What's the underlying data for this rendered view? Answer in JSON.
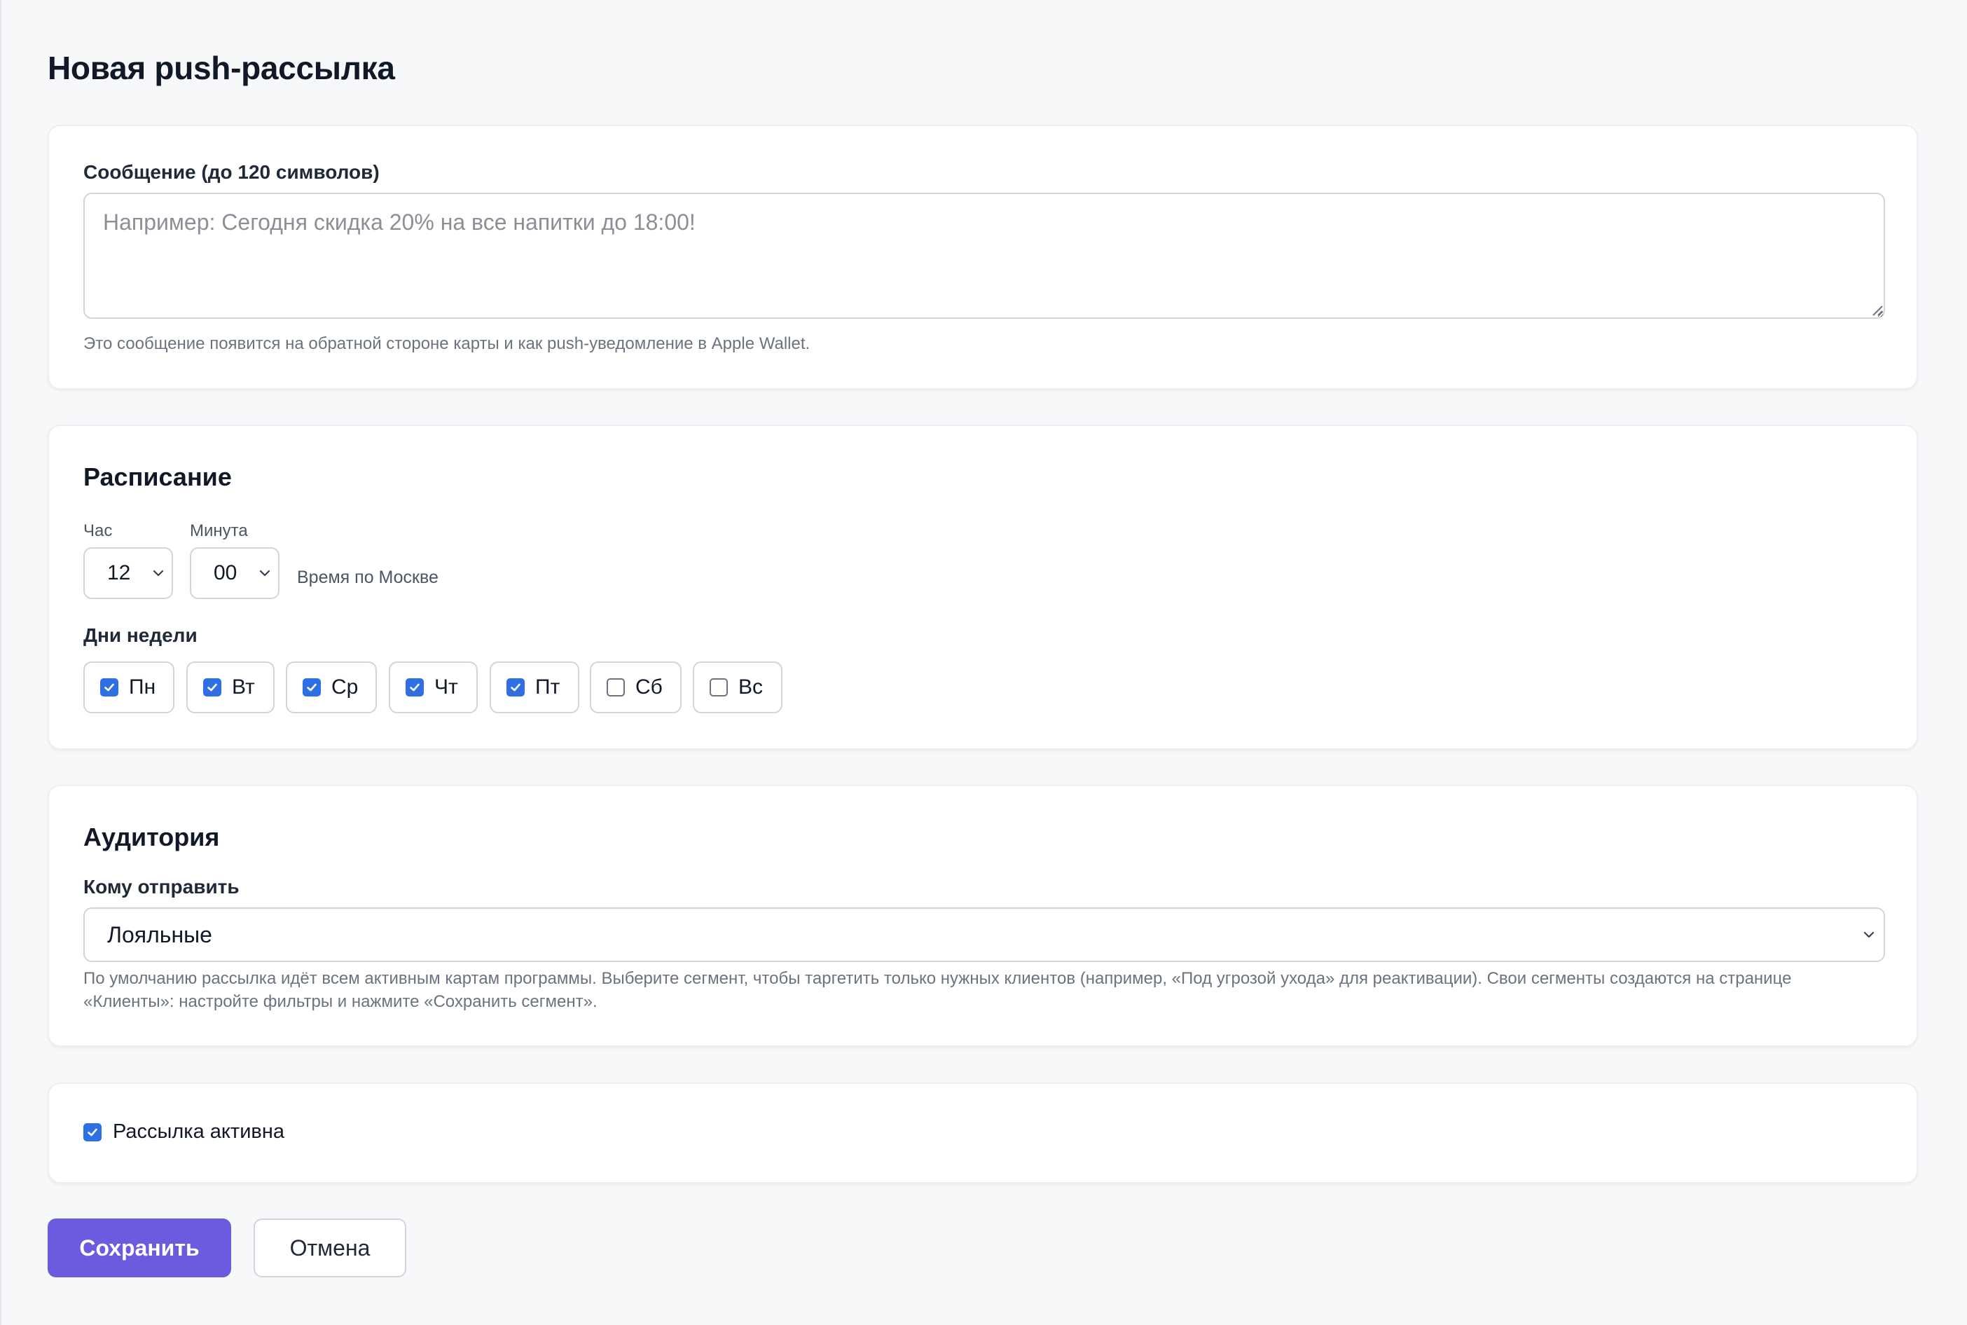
{
  "page": {
    "title": "Новая push-рассылка"
  },
  "message": {
    "label": "Сообщение (до 120 символов)",
    "value": "",
    "placeholder": "Например: Сегодня скидка 20% на все напитки до 18:00!",
    "hint": "Это сообщение появится на обратной стороне карты и как push-уведомление в Apple Wallet."
  },
  "schedule": {
    "title": "Расписание",
    "hour_label": "Час",
    "hour_value": "12",
    "minute_label": "Минута",
    "minute_value": "00",
    "timezone_note": "Время по Москве",
    "days_label": "Дни недели",
    "days": [
      {
        "label": "Пн",
        "checked": true
      },
      {
        "label": "Вт",
        "checked": true
      },
      {
        "label": "Ср",
        "checked": true
      },
      {
        "label": "Чт",
        "checked": true
      },
      {
        "label": "Пт",
        "checked": true
      },
      {
        "label": "Сб",
        "checked": false
      },
      {
        "label": "Вс",
        "checked": false
      }
    ]
  },
  "audience": {
    "title": "Аудитория",
    "label": "Кому отправить",
    "selected": "Лояльные",
    "hint": "По умолчанию рассылка идёт всем активным картам программы. Выберите сегмент, чтобы таргетить только нужных клиентов (например, «Под угрозой ухода» для реактивации). Свои сегменты создаются на странице «Клиенты»: настройте фильтры и нажмите «Сохранить сегмент»."
  },
  "active": {
    "label": "Рассылка активна",
    "checked": true
  },
  "actions": {
    "save_label": "Сохранить",
    "cancel_label": "Отмена"
  },
  "colors": {
    "accent": "#6b5bde",
    "checkbox": "#2f6fe4",
    "background": "#f7f8fa"
  },
  "icons": {
    "checkbox_checked": "check-icon",
    "select_arrow": "chevron-down-icon",
    "textarea_resize": "resize-grip-icon"
  }
}
